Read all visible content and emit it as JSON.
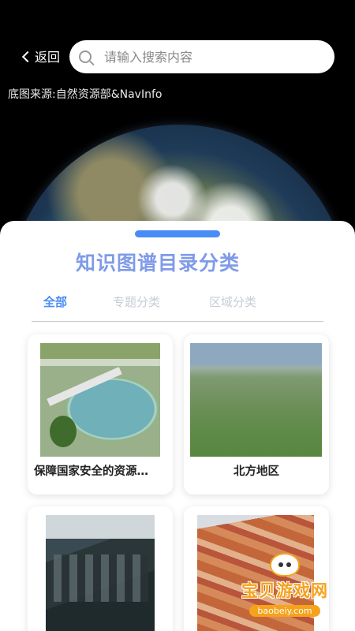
{
  "header": {
    "back_label": "返回",
    "search_placeholder": "请输入搜索内容",
    "map_source": "底图来源:自然资源部&NavInfo"
  },
  "panel": {
    "title": "知识图谱目录分类",
    "tabs": [
      {
        "label": "全部",
        "active": true
      },
      {
        "label": "专题分类",
        "active": false
      },
      {
        "label": "区域分类",
        "active": false
      }
    ],
    "cards": [
      {
        "label": "保障国家安全的资源…",
        "image": "water-treatment-pool-photo"
      },
      {
        "label": "北方地区",
        "image": "grassland-hills-photo"
      },
      {
        "label": "",
        "image": "old-town-houses-photo"
      },
      {
        "label": "",
        "image": "danxia-landform-photo"
      }
    ]
  },
  "watermark": {
    "name": "宝贝游戏网",
    "site": "baobeiy.com"
  },
  "colors": {
    "accent": "#4a8cf7",
    "title": "#7f9be8",
    "inactive_tab": "#c6ccd6",
    "watermark": "#f6a21a"
  }
}
